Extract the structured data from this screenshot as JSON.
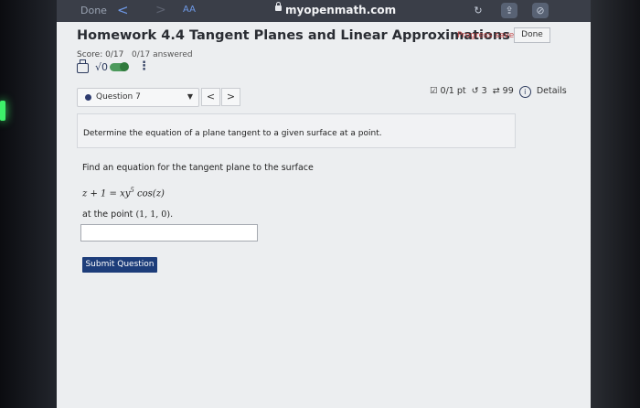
{
  "browser": {
    "done_label": "Done",
    "back_glyph": "<",
    "forward_glyph": ">",
    "text_size_label": "AA",
    "url": "myopenmath.com",
    "icons": [
      "lock-icon",
      "reload-icon",
      "share-icon",
      "compass-icon"
    ]
  },
  "header": {
    "title": "Homework 4.4 Tangent Planes and Linear Approximations",
    "progress_status": "Progress saved",
    "done_button": "Done",
    "score": "Score: 0/17",
    "answered": "0/17 answered",
    "sqrt_glyph": "√0",
    "kebab_glyph": "⋮"
  },
  "question_nav": {
    "selected_question": "Question 7",
    "prev_glyph": "<",
    "next_glyph": ">",
    "points": "0/1 pt",
    "retries": "3",
    "attempts": "99",
    "details_label": "Details"
  },
  "question": {
    "instruction": "Determine the equation of a plane tangent to a given surface at a point.",
    "prompt": "Find an equation for the tangent plane to the surface",
    "equation_lhs": "z + 1 = xy",
    "equation_exp": "5",
    "equation_rhs": " cos(z)",
    "at_point_label": "at the point ",
    "point": "(1, 1, 0)",
    "point_suffix": ".",
    "answer_value": "",
    "submit_label": "Submit Question"
  },
  "colors": {
    "accent": "#1d3d7a",
    "progress_text": "#c44a4a",
    "toggle": "#4c9a5c"
  }
}
